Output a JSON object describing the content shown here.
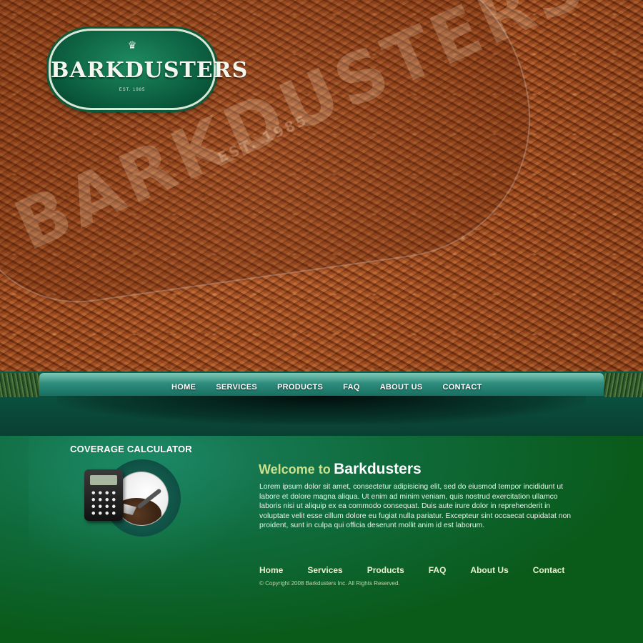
{
  "hero": {
    "watermark_text": "BARKDUSTERS",
    "watermark_est": "EST. 1985"
  },
  "logo": {
    "brand": "BARKDUSTERS",
    "est": "EST. 1985",
    "crown_icon": "crown-icon"
  },
  "nav": {
    "items": [
      {
        "label": "HOME"
      },
      {
        "label": "SERVICES"
      },
      {
        "label": "PRODUCTS"
      },
      {
        "label": "FAQ"
      },
      {
        "label": "ABOUT US"
      },
      {
        "label": "CONTACT"
      }
    ]
  },
  "calculator": {
    "title": "COVERAGE CALCULATOR",
    "icons": [
      "calculator-icon",
      "shovel-icon"
    ]
  },
  "welcome": {
    "prefix": "Welcome to",
    "brand": "Barkdusters",
    "body": "Lorem ipsum dolor sit amet, consectetur adipisicing elit, sed do eiusmod tempor incididunt ut labore et dolore magna aliqua. Ut enim ad minim veniam, quis nostrud exercitation ullamco laboris nisi ut aliquip ex ea commodo consequat. Duis aute irure dolor in reprehenderit in voluptate velit esse cillum dolore eu fugiat nulla pariatur. Excepteur sint occaecat cupidatat non proident, sunt in culpa qui officia deserunt mollit anim id est laborum."
  },
  "footer": {
    "links": [
      {
        "label": "Home"
      },
      {
        "label": "Services"
      },
      {
        "label": "Products"
      },
      {
        "label": "FAQ"
      },
      {
        "label": "About Us"
      },
      {
        "label": "Contact"
      }
    ],
    "copyright": "© Copyright 2008 Barkdusters Inc. All Rights Reserved."
  },
  "colors": {
    "brand_green": "#0a5a3c",
    "page_green": "#0a5a1a",
    "accent_lime": "#cde08a",
    "bark_brown": "#8c4018"
  }
}
